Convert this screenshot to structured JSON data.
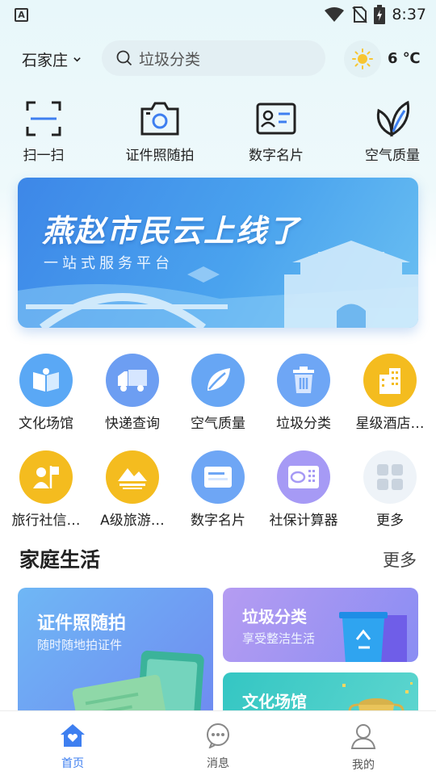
{
  "status_bar": {
    "time": "8:37",
    "app_badge": "A"
  },
  "header": {
    "city": "石家庄",
    "search_placeholder": "垃圾分类",
    "temperature": "6 ℃"
  },
  "quick_tools": [
    {
      "label": "扫一扫",
      "icon": "scan-icon"
    },
    {
      "label": "证件照随拍",
      "icon": "camera-icon"
    },
    {
      "label": "数字名片",
      "icon": "id-card-icon"
    },
    {
      "label": "空气质量",
      "icon": "leaf-icon"
    }
  ],
  "banner": {
    "title": "燕赵市民云上线了",
    "subtitle": "一站式服务平台"
  },
  "services_row1": [
    {
      "label": "文化场馆",
      "icon": "book-icon",
      "color": "#5aa8f5"
    },
    {
      "label": "快递查询",
      "icon": "truck-icon",
      "color": "#6d9ef2"
    },
    {
      "label": "空气质量",
      "icon": "leaf-icon",
      "color": "#67a6f4"
    },
    {
      "label": "垃圾分类",
      "icon": "trash-icon",
      "color": "#6ea6f5"
    },
    {
      "label": "星级酒店…",
      "icon": "building-icon",
      "color": "#f4bc1f"
    }
  ],
  "services_row2": [
    {
      "label": "旅行社信…",
      "icon": "flag-person-icon",
      "color": "#f4bc1f"
    },
    {
      "label": "A级旅游…",
      "icon": "mountain-icon",
      "color": "#f4bc1f"
    },
    {
      "label": "数字名片",
      "icon": "card-icon",
      "color": "#6ea6f5"
    },
    {
      "label": "社保计算器",
      "icon": "calculator-icon",
      "color": "#a69af5"
    },
    {
      "label": "更多",
      "icon": "grid-icon",
      "color": "#eef3f8"
    }
  ],
  "family": {
    "title": "家庭生活",
    "more": "更多",
    "cards": [
      {
        "title": "证件照随拍",
        "subtitle": "随时随地拍证件"
      },
      {
        "title": "垃圾分类",
        "subtitle": "享受整洁生活"
      },
      {
        "title": "文化场馆",
        "subtitle": ""
      }
    ]
  },
  "bottom_nav": [
    {
      "label": "首页",
      "icon": "home-icon",
      "active": true
    },
    {
      "label": "消息",
      "icon": "message-icon",
      "active": false
    },
    {
      "label": "我的",
      "icon": "user-icon",
      "active": false
    }
  ],
  "colors": {
    "accent": "#3e7ff0",
    "yellow": "#f4bc1f"
  }
}
